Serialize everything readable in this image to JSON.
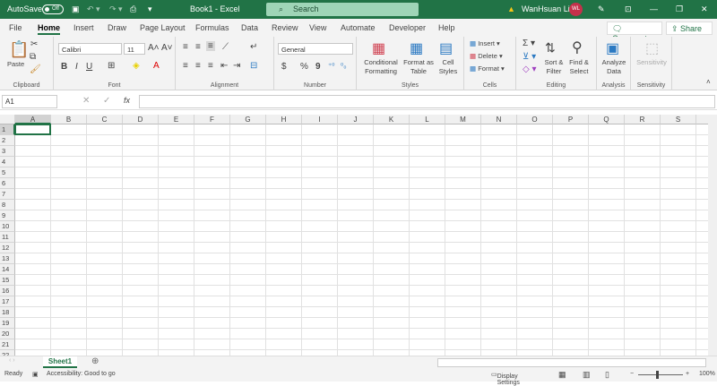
{
  "title_bar": {
    "autosave_label": "AutoSave",
    "autosave_state": "Off",
    "title": "Book1  -  Excel",
    "search_placeholder": "Search",
    "user_name": "WanHsuan Lin",
    "user_initials": "WL",
    "accent": "#217346"
  },
  "tabs": [
    "File",
    "Home",
    "Insert",
    "Draw",
    "Page Layout",
    "Formulas",
    "Data",
    "Review",
    "View",
    "Automate",
    "Developer",
    "Help"
  ],
  "active_tab": "Home",
  "comments_label": "Comments",
  "share_label": "Share",
  "ribbon": {
    "clipboard": {
      "label": "Clipboard",
      "paste": "Paste"
    },
    "font": {
      "label": "Font",
      "name": "Calibri",
      "size": "11",
      "bold": "B",
      "italic": "I",
      "underline": "U"
    },
    "alignment": {
      "label": "Alignment"
    },
    "number": {
      "label": "Number",
      "format": "General",
      "currency": "$",
      "percent": "%",
      "comma": "9"
    },
    "styles": {
      "label": "Styles",
      "conditional": "Conditional Formatting",
      "format_table": "Format as Table",
      "cell_styles": "Cell Styles"
    },
    "cells": {
      "label": "Cells",
      "insert": "Insert",
      "delete": "Delete",
      "format": "Format"
    },
    "editing": {
      "label": "Editing",
      "sort": "Sort & Filter",
      "find": "Find & Select"
    },
    "analysis": {
      "label": "Analysis",
      "analyze": "Analyze Data"
    },
    "sensitivity": {
      "label": "Sensitivity",
      "button": "Sensitivity"
    }
  },
  "formula_bar": {
    "name_box": "A1",
    "fx": "fx",
    "value": ""
  },
  "columns": [
    "A",
    "B",
    "C",
    "D",
    "E",
    "F",
    "G",
    "H",
    "I",
    "J",
    "K",
    "L",
    "M",
    "N",
    "O",
    "P",
    "Q",
    "R",
    "S",
    "T"
  ],
  "rows": [
    "1",
    "2",
    "3",
    "4",
    "5",
    "6",
    "7",
    "8",
    "9",
    "10",
    "11",
    "12",
    "13",
    "14",
    "15",
    "16",
    "17",
    "18",
    "19",
    "20",
    "21",
    "22"
  ],
  "sheets": [
    "Sheet1"
  ],
  "status": {
    "ready": "Ready",
    "accessibility": "Accessibility: Good to go",
    "display_settings": "Display Settings",
    "zoom": "100%"
  }
}
